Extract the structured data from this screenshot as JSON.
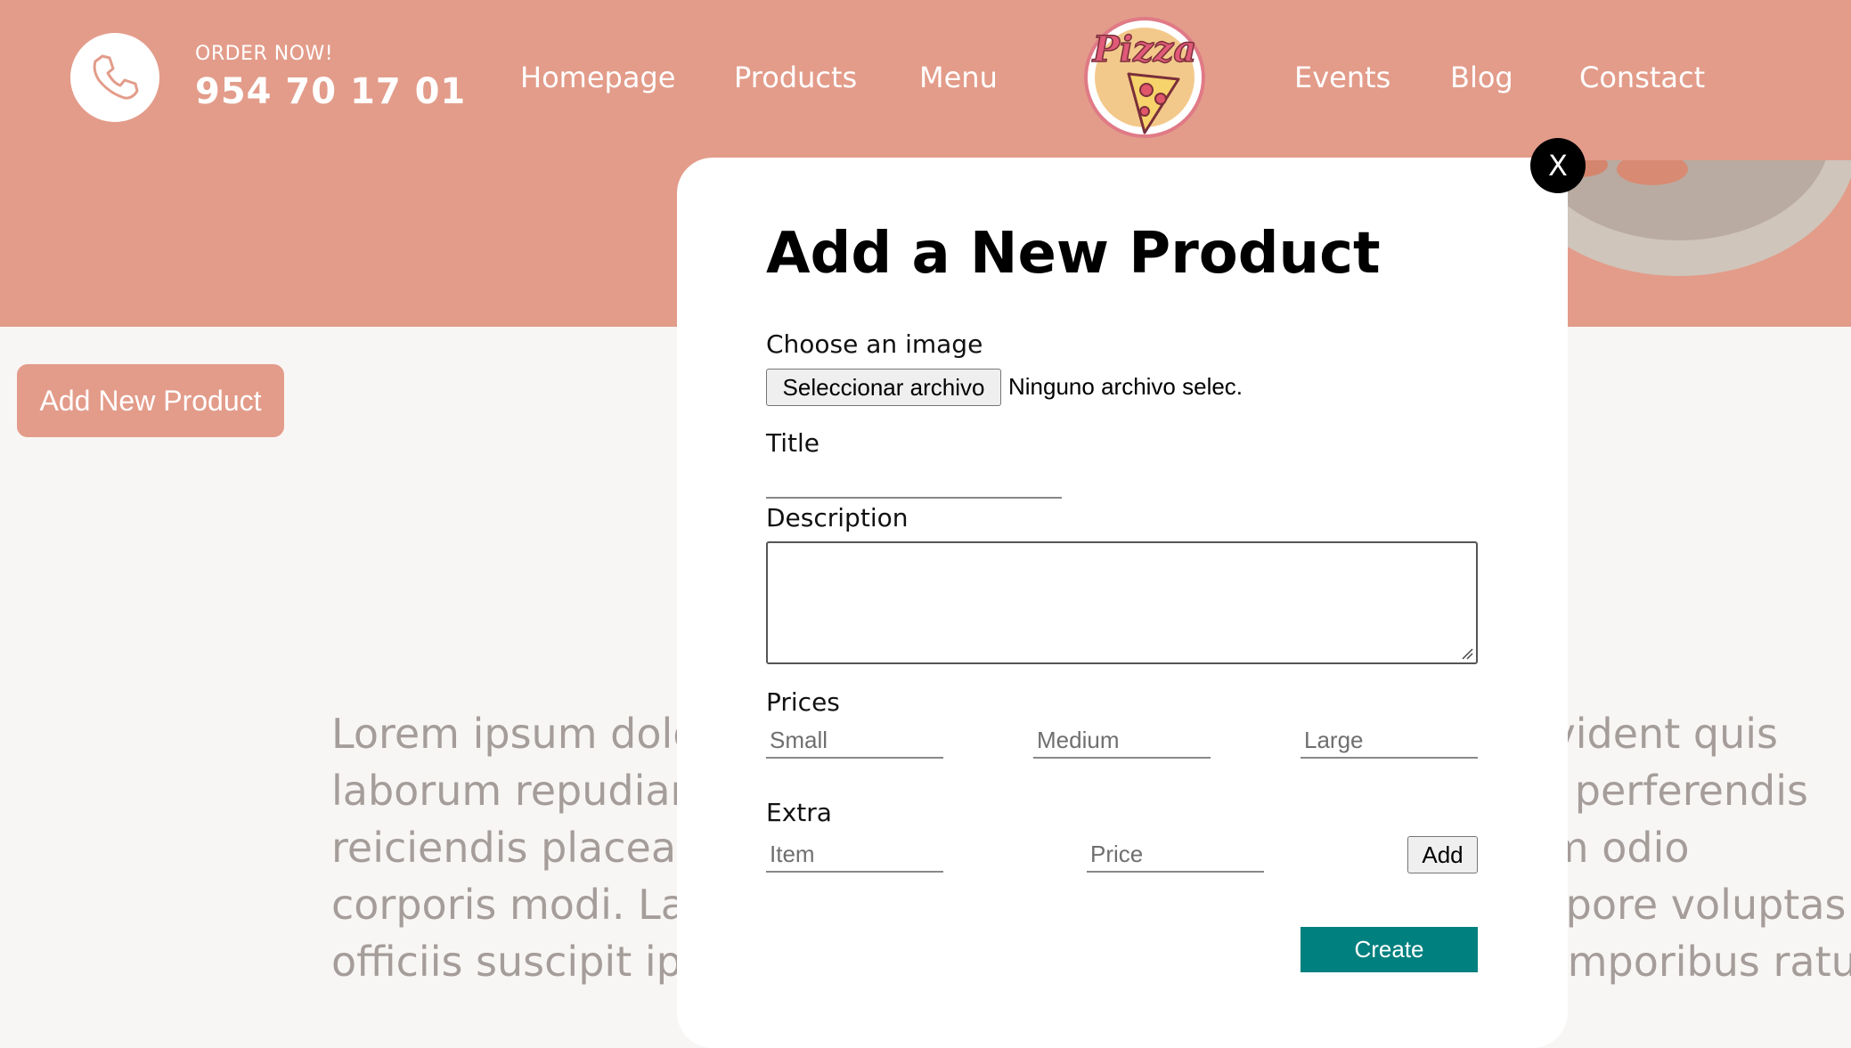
{
  "header": {
    "order_label": "ORDER NOW!",
    "phone_number": "954 70 17 01",
    "phone_icon": "phone-icon",
    "logo_text": "Pizza",
    "nav": [
      {
        "label": "Homepage"
      },
      {
        "label": "Products"
      },
      {
        "label": "Menu"
      },
      {
        "label": "Events"
      },
      {
        "label": "Blog"
      },
      {
        "label": "Constact"
      }
    ],
    "background_color": "#e39c8a"
  },
  "page": {
    "add_button_label": "Add New Product",
    "lorem_lines": [
      "Lorem ipsum dolor sit amet consectetur adipisicing elit. Provident quis",
      "laborum repudiandae velit ratione quae sequi sint nobis aut perferendis",
      "reiciendis placeat cum officia dolorem ad nihil! Totam, harum odio",
      "corporis modi. Laudantium ipsum aspernatur quisquam tempore voluptas sit",
      "officiis suscipit ipsam veniam dicta nihil, similique ut cum temporibus ratus!"
    ]
  },
  "modal": {
    "close_label": "X",
    "title": "Add a New Product",
    "image_label": "Choose an image",
    "file_button": "Seleccionar archivo",
    "file_status": "Ninguno archivo selec.",
    "title_label": "Title",
    "title_value": "",
    "description_label": "Description",
    "description_value": "",
    "prices_label": "Prices",
    "price_placeholders": {
      "small": "Small",
      "medium": "Medium",
      "large": "Large"
    },
    "extra_label": "Extra",
    "extra_placeholders": {
      "item": "Item",
      "price": "Price"
    },
    "add_button": "Add",
    "create_button": "Create",
    "create_color": "#00807f"
  }
}
